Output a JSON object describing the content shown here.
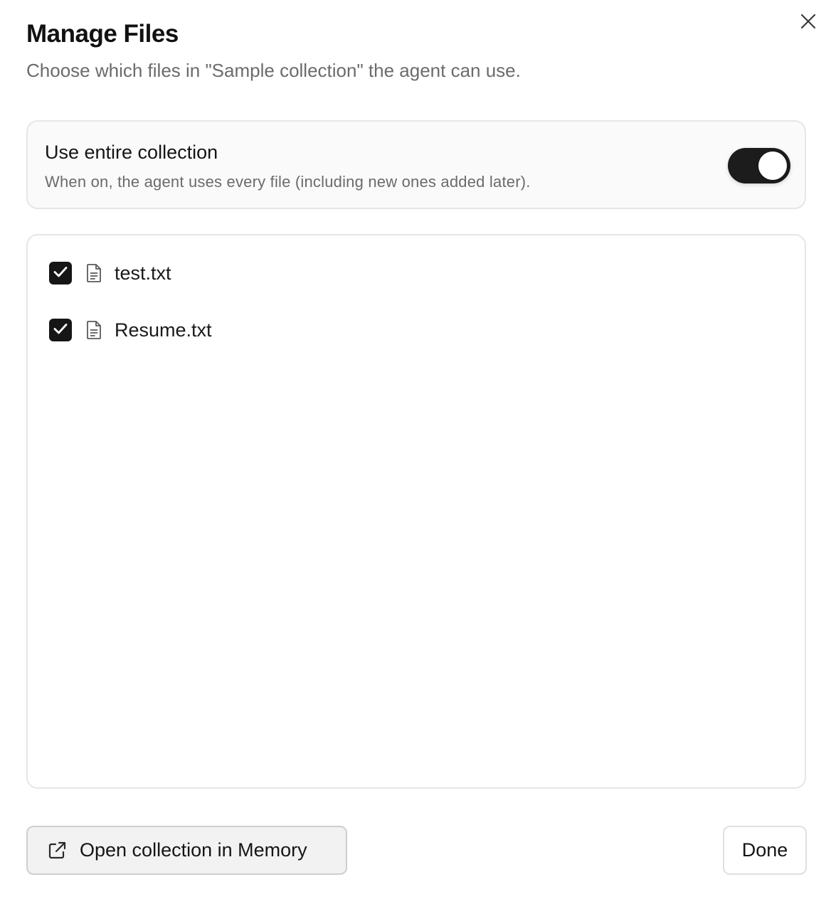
{
  "dialog": {
    "title": "Manage Files",
    "subtitle": "Choose which files in \"Sample collection\" the agent can use."
  },
  "collection_toggle": {
    "title": "Use entire collection",
    "description": "When on, the agent uses every file (including new ones added later).",
    "state": "on"
  },
  "files": [
    {
      "name": "test.txt",
      "checked": true,
      "icon": "document-icon"
    },
    {
      "name": "Resume.txt",
      "checked": true,
      "icon": "document-icon"
    }
  ],
  "footer": {
    "open_label": "Open collection in Memory",
    "open_icon": "external-link-icon",
    "done_label": "Done"
  },
  "icons": {
    "close": "close-icon",
    "check": "checkmark-icon"
  },
  "colors": {
    "accent": "#161616",
    "muted_text": "#6b6b6b",
    "border": "#e6e6e6"
  }
}
